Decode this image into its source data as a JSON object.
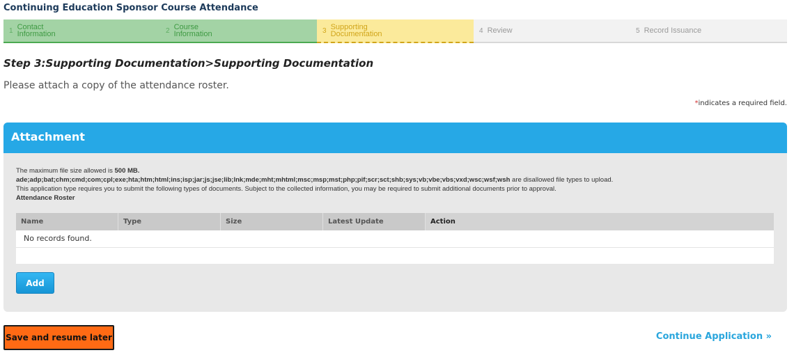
{
  "page": {
    "title": "Continuing Education Sponsor Course Attendance"
  },
  "steps": [
    {
      "num": "1",
      "label_line1": "Contact",
      "label_line2": "Information",
      "state": "done"
    },
    {
      "num": "2",
      "label_line1": "Course",
      "label_line2": "Information",
      "state": "done"
    },
    {
      "num": "3",
      "label_line1": "Supporting",
      "label_line2": "Documentation",
      "state": "current"
    },
    {
      "num": "4",
      "label_line1": "Review",
      "label_line2": "",
      "state": "todo"
    },
    {
      "num": "5",
      "label_line1": "Record Issuance",
      "label_line2": "",
      "state": "todo"
    }
  ],
  "content": {
    "step_heading": "Step 3:Supporting Documentation>Supporting Documentation",
    "instruction": "Please attach a copy of the attendance roster.",
    "required_star": "*",
    "required_note": "indicates a required field."
  },
  "attachment": {
    "title": "Attachment",
    "max_size_prefix": "The maximum file size allowed is",
    "max_size_value": "500 MB.",
    "disallowed_types": "ade;adp;bat;chm;cmd;com;cpl;exe;hta;htm;html;ins;isp;jar;js;jse;lib;lnk;mde;mht;mhtml;msc;msp;mst;php;pif;scr;sct;shb;sys;vb;vbe;vbs;vxd;wsc;wsf;wsh",
    "disallowed_suffix": "are disallowed file types to upload.",
    "requirement_text": "This application type requires you to submit the following types of documents. Subject to the collected information, you may be required to submit additional documents prior to approval.",
    "required_doc": "Attendance Roster",
    "columns": [
      "Name",
      "Type",
      "Size",
      "Latest Update",
      "Action"
    ],
    "empty_text": "No records found.",
    "add_label": "Add"
  },
  "footer": {
    "save_label": "Save and resume later",
    "continue_label": "Continue Application »"
  },
  "colors": {
    "step_done_bg": "#a3d3a5",
    "step_current_bg": "#fbea9b",
    "panel_header": "#26a8e6",
    "save_button": "#ff6a14",
    "continue_link": "#2aa6dd"
  }
}
